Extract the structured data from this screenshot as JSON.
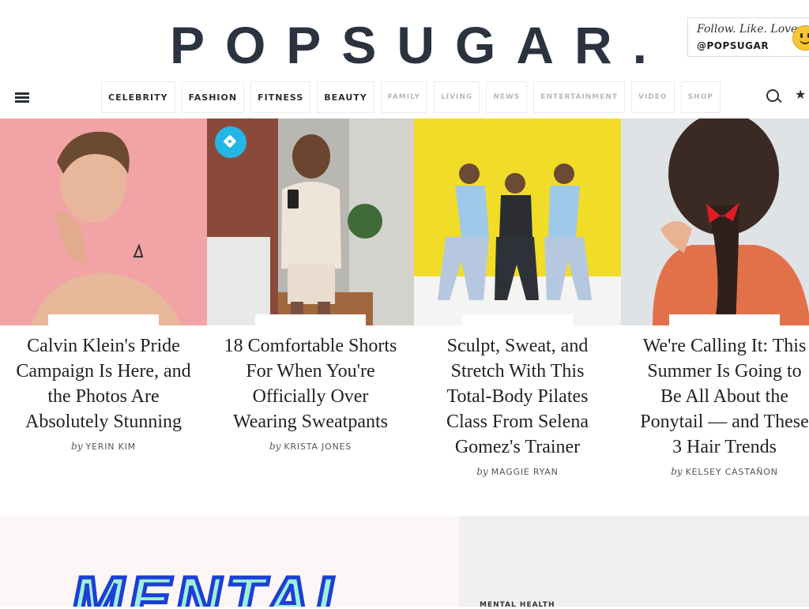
{
  "header": {
    "logo": "POPSUGAR.",
    "follow_tagline": "Follow. Like. Love.",
    "follow_handle": "@POPSUGAR"
  },
  "nav": {
    "items": [
      {
        "label": "CELEBRITY"
      },
      {
        "label": "FASHION"
      },
      {
        "label": "FITNESS"
      },
      {
        "label": "BEAUTY"
      },
      {
        "label": "FAMILY"
      },
      {
        "label": "LIVING"
      },
      {
        "label": "NEWS"
      },
      {
        "label": "ENTERTAINMENT"
      },
      {
        "label": "VIDEO"
      },
      {
        "label": "SHOP"
      }
    ]
  },
  "cards": [
    {
      "title": "Calvin Klein's Pride Campaign Is Here, and the Photos Are Absolutely Stunning",
      "by": "by",
      "author": "YERIN KIM"
    },
    {
      "title": "18 Comfortable Shorts For When You're Officially Over Wearing Sweatpants",
      "by": "by",
      "author": "KRISTA JONES"
    },
    {
      "title": "Sculpt, Sweat, and Stretch With This Total-Body Pilates Class From Selena Gomez's Trainer",
      "by": "by",
      "author": "MAGGIE RYAN"
    },
    {
      "title": "We're Calling It: This Summer Is Going to Be All About the Ponytail — and These 3 Hair Trends",
      "by": "by",
      "author": "KELSEY CASTAÑON"
    }
  ],
  "promo": {
    "headline": "MENTAL",
    "label": "MENTAL HEALTH"
  },
  "colors": {
    "logo": "#2b3340",
    "tag_bubble": "#25b6e8",
    "promo_fill": "#9ff0d6",
    "promo_stroke": "#1d3fd6"
  }
}
